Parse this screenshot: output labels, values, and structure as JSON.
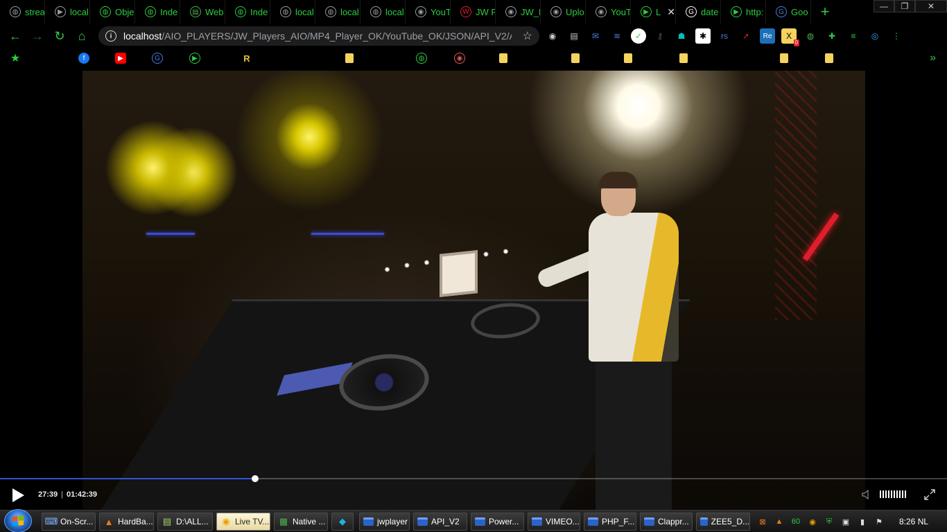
{
  "browser": {
    "tabs": [
      {
        "label": "strea",
        "icon": "globe-icon",
        "color": "#9aa0a6"
      },
      {
        "label": "local",
        "icon": "play-circle-icon",
        "color": "#9aa0a6"
      },
      {
        "label": "Obje",
        "icon": "globe-icon",
        "color": "#2ecc40"
      },
      {
        "label": "Inde",
        "icon": "globe-icon",
        "color": "#2ecc40"
      },
      {
        "label": "Web",
        "icon": "document-icon",
        "color": "#4caf50"
      },
      {
        "label": "Inde",
        "icon": "globe-icon",
        "color": "#2ecc40"
      },
      {
        "label": "local",
        "icon": "globe-icon",
        "color": "#9aa0a6"
      },
      {
        "label": "local",
        "icon": "globe-icon",
        "color": "#9aa0a6"
      },
      {
        "label": "local",
        "icon": "globe-icon",
        "color": "#9aa0a6"
      },
      {
        "label": "YouT",
        "icon": "github-icon",
        "color": "#9aa0a6"
      },
      {
        "label": "JW P",
        "icon": "jw-icon",
        "color": "#e21d2b"
      },
      {
        "label": "JW_F",
        "icon": "github-icon",
        "color": "#9aa0a6"
      },
      {
        "label": "Uplo",
        "icon": "github-icon",
        "color": "#9aa0a6"
      },
      {
        "label": "YouT",
        "icon": "github-icon",
        "color": "#9aa0a6"
      },
      {
        "label": "L",
        "icon": "play-circle-icon",
        "color": "#2ecc40",
        "active": true,
        "close": "✕"
      },
      {
        "label": "date",
        "icon": "google-icon",
        "color": "#ffffff"
      },
      {
        "label": "http:",
        "icon": "play-circle-icon",
        "color": "#2ecc40"
      },
      {
        "label": "Goo",
        "icon": "translate-icon",
        "color": "#4a7de2"
      }
    ],
    "new_tab": "+",
    "window_controls": {
      "minimize": "—",
      "restore": "❐",
      "close": "✕"
    },
    "url_host": "localhost",
    "url_path": "/AIO_PLAYERS/JW_Players_AIO/MP4_Player_OK/YouTube_OK/JSON/API_V2/API_...",
    "extensions": [
      {
        "icon": "globe-icon",
        "glyph": "◉",
        "color": "#cccccc"
      },
      {
        "icon": "reader-icon",
        "glyph": "▤",
        "color": "#cccccc"
      },
      {
        "icon": "mail-icon",
        "glyph": "✉",
        "color": "#4a7de2"
      },
      {
        "icon": "buffer-icon",
        "glyph": "≋",
        "color": "#4a7de2"
      },
      {
        "icon": "grammarly-icon",
        "glyph": "✓",
        "color": "#2ecc40"
      },
      {
        "icon": "key-icon",
        "glyph": "⚷",
        "color": "#555555"
      },
      {
        "icon": "android-icon",
        "glyph": "☗",
        "color": "#00c0c0"
      },
      {
        "icon": "asterisk-icon",
        "glyph": "✱",
        "color": "#000000"
      },
      {
        "icon": "rs-icon",
        "glyph": "rs",
        "color": "#4a7de2"
      },
      {
        "icon": "arrow-icon",
        "glyph": "➚",
        "color": "#cc2222"
      },
      {
        "icon": "re-icon",
        "glyph": "Re",
        "color": "#ffffff"
      },
      {
        "icon": "x-badge-icon",
        "glyph": "X",
        "color": "#f4d35e",
        "badge": "0"
      },
      {
        "icon": "earth-icon",
        "glyph": "◍",
        "color": "#4caf50"
      },
      {
        "icon": "puzzle-icon",
        "glyph": "✚",
        "color": "#2ecc40"
      },
      {
        "icon": "playlist-icon",
        "glyph": "≡",
        "color": "#2ecc40"
      },
      {
        "icon": "record-icon",
        "glyph": "◎",
        "color": "#2a9df4"
      },
      {
        "icon": "menu-icon",
        "glyph": "⋮",
        "color": "#2ecc40"
      }
    ],
    "bookmarks": [
      {
        "icon": "star-icon",
        "glyph": "★"
      },
      {
        "icon": "facebook-icon",
        "glyph": "f"
      },
      {
        "icon": "youtube-icon",
        "glyph": "▶"
      },
      {
        "icon": "translate-icon",
        "glyph": "G"
      },
      {
        "icon": "play-circle-icon",
        "glyph": "▶"
      },
      {
        "icon": "r-icon",
        "glyph": "R"
      },
      {
        "icon": "folder-icon",
        "glyph": ""
      },
      {
        "icon": "globe-icon",
        "glyph": "◍"
      },
      {
        "icon": "podcast-icon",
        "glyph": "◉"
      },
      {
        "icon": "folder-icon",
        "glyph": ""
      },
      {
        "icon": "folder-icon",
        "glyph": ""
      },
      {
        "icon": "folder-icon",
        "glyph": ""
      },
      {
        "icon": "folder-icon",
        "glyph": ""
      },
      {
        "icon": "folder-icon",
        "glyph": ""
      },
      {
        "icon": "folder-icon",
        "glyph": ""
      }
    ],
    "bookmarks_more": "»"
  },
  "player": {
    "current_time": "27:39",
    "separator": "|",
    "duration": "01:42:39",
    "progress_fraction": 0.2694,
    "accent_color": "#2f55d4"
  },
  "taskbar": {
    "items": [
      {
        "label": "On-Scr...",
        "icon": "keyboard-icon"
      },
      {
        "label": "HardBa...",
        "icon": "vlc-icon"
      },
      {
        "label": "D:\\ALL...",
        "icon": "notepad-icon"
      },
      {
        "label": "Live TV...",
        "icon": "chrome-icon",
        "active": true
      },
      {
        "label": "Native ...",
        "icon": "app-icon"
      },
      {
        "label": "",
        "icon": "kodi-icon"
      },
      {
        "label": "jwplayer",
        "icon": "folder-icon"
      },
      {
        "label": "API_V2",
        "icon": "folder-icon"
      },
      {
        "label": "Power...",
        "icon": "folder-icon"
      },
      {
        "label": "VIMEO...",
        "icon": "folder-icon"
      },
      {
        "label": "PHP_F...",
        "icon": "folder-icon"
      },
      {
        "label": "Clappr...",
        "icon": "folder-icon"
      },
      {
        "label": "ZEE5_D...",
        "icon": "folder-icon"
      }
    ],
    "tray": [
      {
        "icon": "xampp-icon",
        "glyph": "⊠",
        "color": "#f07d1a"
      },
      {
        "icon": "vlc-icon",
        "glyph": "▲",
        "color": "#f07d1a"
      },
      {
        "icon": "sixty-icon",
        "glyph": "60",
        "color": "#2ecc40"
      },
      {
        "icon": "chrome-icon",
        "glyph": "◉",
        "color": "#e8a100"
      },
      {
        "icon": "shield-icon",
        "glyph": "⛨",
        "color": "#2ecc40"
      },
      {
        "icon": "device-icon",
        "glyph": "▣",
        "color": "#dddddd"
      },
      {
        "icon": "signal-icon",
        "glyph": "▮",
        "color": "#dddddd"
      },
      {
        "icon": "flag-icon",
        "glyph": "⚑",
        "color": "#dddddd"
      }
    ],
    "clock": "8:26",
    "language": "NL"
  }
}
